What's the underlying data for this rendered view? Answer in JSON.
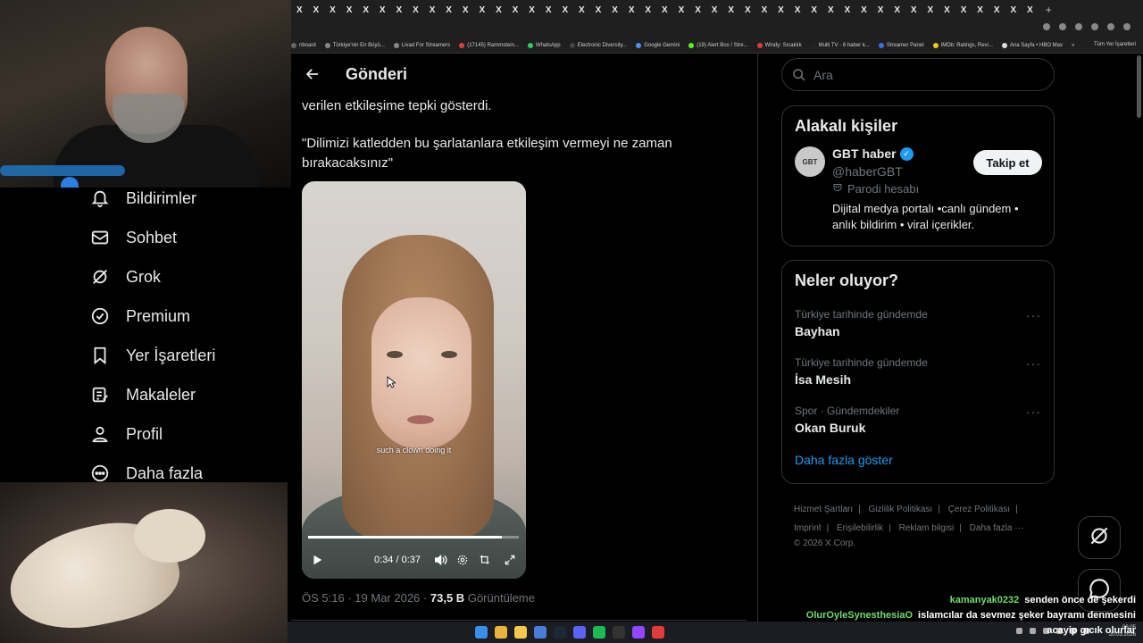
{
  "browser": {
    "tab_glyph": "X",
    "tab_count": 45,
    "new_tab": "+",
    "bookmarks": [
      {
        "label": "nboard",
        "color": "#666"
      },
      {
        "label": "Türkiye'nin En Büyü...",
        "color": "#888"
      },
      {
        "label": "Livad For Streamers",
        "color": "#888"
      },
      {
        "label": "(17145) Rammstein...",
        "color": "#e23b3b"
      },
      {
        "label": "WhatsApp",
        "color": "#25d366"
      },
      {
        "label": "Electronic Diversity...",
        "color": "#444"
      },
      {
        "label": "Google Gemini",
        "color": "#4f8ef7"
      },
      {
        "label": "(19) Alert Box / Stre...",
        "color": "#53fc18"
      },
      {
        "label": "Windy: Sıcaklık",
        "color": "#e23b3b"
      },
      {
        "label": "Multi TV - 6 haber k...",
        "color": "#222"
      },
      {
        "label": "Streamer Panel",
        "color": "#3a6df0"
      },
      {
        "label": "IMDb: Ratings, Revi...",
        "color": "#f5c518"
      },
      {
        "label": "Ana Sayfa • HBO Max",
        "color": "#ddd"
      }
    ],
    "bookmarks_overflow": "»",
    "all_bookmarks": "Tüm Yer İşaretleri"
  },
  "nav": {
    "items": [
      {
        "label": "Bildirimler",
        "icon": "bell-icon"
      },
      {
        "label": "Sohbet",
        "icon": "mail-icon"
      },
      {
        "label": "Grok",
        "icon": "grok-icon"
      },
      {
        "label": "Premium",
        "icon": "verified-badge-icon"
      },
      {
        "label": "Yer İşaretleri",
        "icon": "bookmark-icon"
      },
      {
        "label": "Makaleler",
        "icon": "article-icon"
      },
      {
        "label": "Profil",
        "icon": "person-icon"
      },
      {
        "label": "Daha fazla",
        "icon": "more-circle-icon"
      }
    ]
  },
  "post": {
    "header_title": "Gönderi",
    "text_line_top": "verilen etkileşime tepki gösterdi.",
    "quote": "\"Dilimizi katledden bu şarlatanlara etkileşim vermeyi ne zaman bırakacaksınız\"",
    "video": {
      "caption": "such a clown doing it",
      "time": "0:34 / 0:37",
      "progress_fraction": 0.919
    },
    "meta": {
      "time": "ÖS 5:16",
      "dot": "·",
      "date": "19 Mar 2026",
      "views_count": "73,5 B",
      "views_label": "Görüntüleme"
    }
  },
  "sidebar": {
    "search_placeholder": "Ara",
    "related": {
      "title": "Alakalı kişiler",
      "avatar_text": "GBT",
      "name": "GBT haber",
      "handle": "@haberGBT",
      "parody_label": "Parodi hesabı",
      "bio": "Dijital medya portalı •canlı gündem • anlık bildirim • viral içerikler.",
      "follow_label": "Takip et"
    },
    "trends": {
      "title": "Neler oluyor?",
      "items": [
        {
          "context": "Türkiye tarihinde gündemde",
          "topic": "Bayhan"
        },
        {
          "context": "Türkiye tarihinde gündemde",
          "topic": "İsa Mesih"
        },
        {
          "context": "Spor · Gündemdekiler",
          "topic": "Okan Buruk"
        }
      ],
      "more_glyph": "···",
      "show_more": "Daha fazla göster"
    },
    "footer": {
      "links_row1": [
        "Hizmet Şartları",
        "Gizlilik Politikası",
        "Çerez Politikası"
      ],
      "links_row2": [
        "Imprint",
        "Erişilebilirlik",
        "Reklam bilgisi",
        "Daha fazla ···"
      ],
      "copyright": "© 2026 X Corp."
    }
  },
  "chat": [
    {
      "user": "kamanyak0232",
      "message": "senden önce de şekerdi"
    },
    {
      "user": "OlurOyleSynesthesiaO",
      "message": "islamcılar da sevmez şeker bayramı denmesini"
    },
    {
      "user": "",
      "message": "acayip gıcık olurlar"
    }
  ],
  "taskbar": {
    "clock_time": "06:05",
    "clock_date": "20.03.2026"
  },
  "colors": {
    "accent": "#1d9bf0",
    "background": "#000000",
    "text": "#e7e9ea",
    "muted": "#71767b",
    "border": "#2f3336",
    "chat_user": "#6fdc6f"
  }
}
